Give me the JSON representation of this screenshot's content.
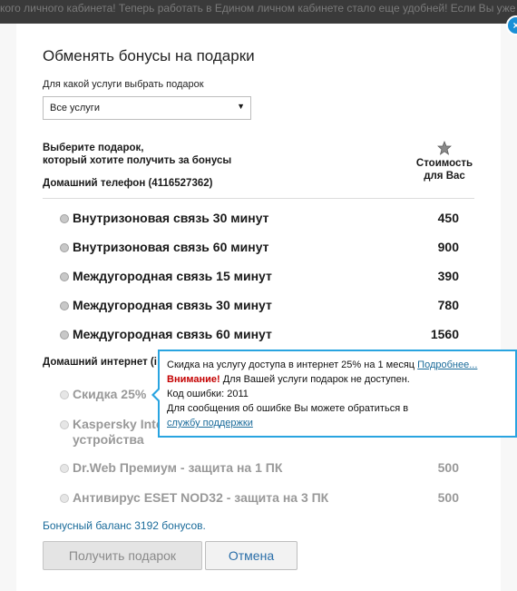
{
  "background": {
    "text": "кого личного кабинета! Теперь работать в Едином личном кабинете стало еще удобней! Если Вы уже"
  },
  "close_label": "×",
  "dialog": {
    "title": "Обменять бонусы на подарки",
    "service_label": "Для какой услуги выбрать подарок",
    "service_select": {
      "selected": "Все услуги",
      "arrow": "▼"
    },
    "column_left": "Выберите подарок,\nкоторый хотите получить за бонусы",
    "column_cost": "Стоимость\nдля Вас"
  },
  "sections": [
    {
      "label": "Домашний телефон (4116527362)",
      "gifts": [
        {
          "name": "Внутризоновая связь 30 минут",
          "price": "450"
        },
        {
          "name": "Внутризоновая связь 60 минут",
          "price": "900"
        },
        {
          "name": "Междугородная связь 15 минут",
          "price": "390"
        },
        {
          "name": "Междугородная связь 30 минут",
          "price": "780"
        },
        {
          "name": "Междугородная связь 60 минут",
          "price": "1560"
        }
      ]
    },
    {
      "label": "Домашний интернет (i",
      "gifts": [
        {
          "name": "Скидка 25%",
          "price": ""
        },
        {
          "name": "Kaspersky Inte\nустройства",
          "price": ""
        },
        {
          "name": "Dr.Web Премиум - защита на 1 ПК",
          "price": "500"
        },
        {
          "name": "Антивирус ESET NOD32 - защита на 3 ПК",
          "price": "500"
        }
      ]
    }
  ],
  "tooltip": {
    "line1": "Скидка на услугу доступа в интернет 25% на 1 месяц",
    "more_link": "Подробнее...",
    "warning_label": "Внимание!",
    "warning_text": "Для Вашей услуги подарок не доступен.",
    "error_code": "Код ошибки: 2011",
    "support_text": "Для сообщения об ошибке Вы можете обратиться в",
    "support_link": "службу поддержки"
  },
  "balance": "Бонусный баланс 3192 бонусов.",
  "buttons": {
    "get_gift": "Получить подарок",
    "cancel": "Отмена"
  },
  "colors": {
    "accent": "#29a4e0",
    "link": "#1a6b9a",
    "warning": "#c40000"
  }
}
